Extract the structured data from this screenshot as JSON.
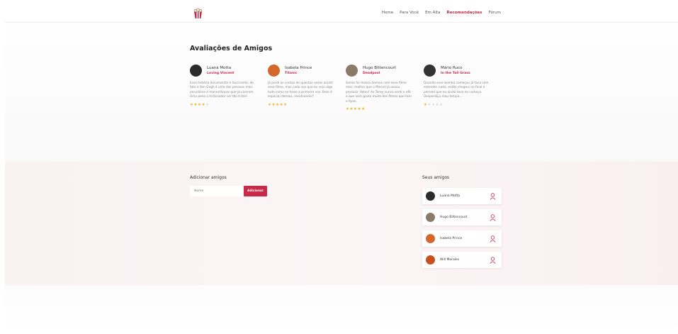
{
  "nav": {
    "links": [
      {
        "label": "Home",
        "active": false
      },
      {
        "label": "Para Você",
        "active": false
      },
      {
        "label": "Em Alta",
        "active": false
      },
      {
        "label": "Recomendações",
        "active": true
      },
      {
        "label": "Fórum",
        "active": false
      }
    ]
  },
  "reviews_section": {
    "title": "Avaliações de Amigos",
    "reviews": [
      {
        "name": "Luana Motta",
        "movie": "Loving Vincent",
        "text": "Essa história documental é fascinante, de fato o Van Gogh é uma das pessoas mais peculiares e maravilhosas que já viveram. Uma pena o historiador ser tão triste!",
        "rating": 4,
        "max_rating": 5,
        "avatar_color": "#2b2b2b"
      },
      {
        "name": "Isabela Prince",
        "movie": "Titanic",
        "text": "Já perdi as contas de quantas vezes assisti esse filme, mas cada vez que eu vejo algo tudo como se fosse a primeira vez. Bree é especial demais, recomendo!!",
        "rating": 5,
        "max_rating": 5,
        "avatar_color": "#d4682c"
      },
      {
        "name": "Hugo Bittencourt",
        "movie": "Deadpool",
        "text": "Gente foi massa demais com esse filme man, melhor que o Marvel já ousou produzir. Valeu! Ao Torey nunca senti o afã o que nem gosto muito dos filmes que tem o Ryan.",
        "rating": 5,
        "max_rating": 5,
        "avatar_color": "#8a7a6a"
      },
      {
        "name": "Mário Ruco",
        "movie": "In the Tall Grass",
        "text": "Quando esse bomba começou já tava sem entender nada, então chegeui no final e percebi que eu ainda tava no começo. Desperdiço meu tempo...",
        "rating": 1,
        "max_rating": 5,
        "avatar_color": "#333333"
      }
    ]
  },
  "add_friends": {
    "title": "Adicionar amigos",
    "input_placeholder": "Nome",
    "button_label": "Adicionar"
  },
  "friends": {
    "title": "Seus amigos",
    "list": [
      {
        "name": "Luana Motta",
        "avatar_color": "#2b2b2b"
      },
      {
        "name": "Hugo Bittencourt",
        "avatar_color": "#8a7a6a"
      },
      {
        "name": "Isabela Prince",
        "avatar_color": "#d4682c"
      },
      {
        "name": "Will Morales",
        "avatar_color": "#c9501e"
      }
    ]
  },
  "colors": {
    "accent": "#c8284a",
    "star": "#f0b429"
  }
}
